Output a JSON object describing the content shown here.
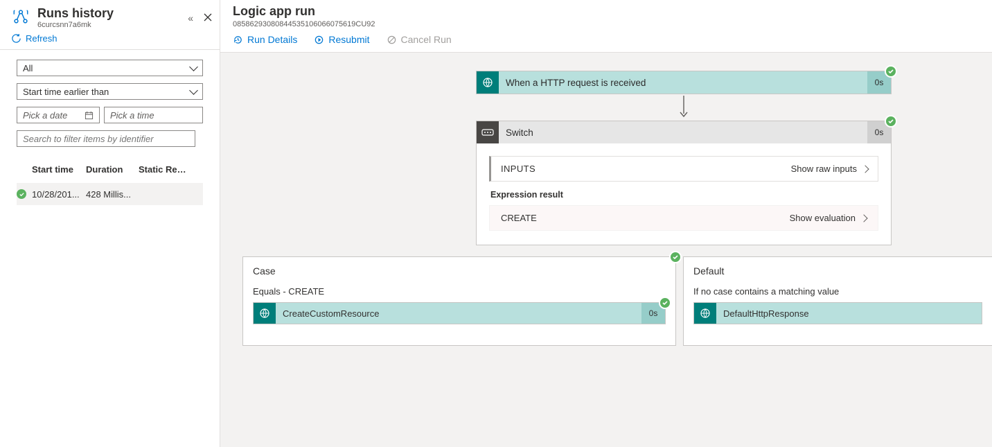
{
  "sidebar": {
    "title": "Runs history",
    "subtitle": "6curcsnn7a6mk",
    "refresh_label": "Refresh",
    "filter_status": "All",
    "filter_time": "Start time earlier than",
    "placeholder_date": "Pick a date",
    "placeholder_time": "Pick a time",
    "search_placeholder": "Search to filter items by identifier",
    "columns": {
      "c1": "Start time",
      "c2": "Duration",
      "c3": "Static Res..."
    },
    "rows": [
      {
        "start": "10/28/201...",
        "duration": "428 Millis...",
        "static": ""
      }
    ]
  },
  "main": {
    "title": "Logic app run",
    "subtitle": "08586293080844535106066075619CU92",
    "toolbar": {
      "details": "Run Details",
      "resubmit": "Resubmit",
      "cancel": "Cancel Run"
    }
  },
  "workflow": {
    "trigger": {
      "label": "When a HTTP request is received",
      "duration": "0s"
    },
    "switch": {
      "label": "Switch",
      "duration": "0s",
      "inputs_label": "INPUTS",
      "show_raw": "Show raw inputs",
      "expr_label": "Expression result",
      "expr_value": "CREATE",
      "show_eval": "Show evaluation"
    },
    "case": {
      "title": "Case",
      "condition": "Equals - CREATE",
      "step_label": "CreateCustomResource",
      "step_duration": "0s"
    },
    "default": {
      "title": "Default",
      "condition": "If no case contains a matching value",
      "step_label": "DefaultHttpResponse"
    }
  }
}
